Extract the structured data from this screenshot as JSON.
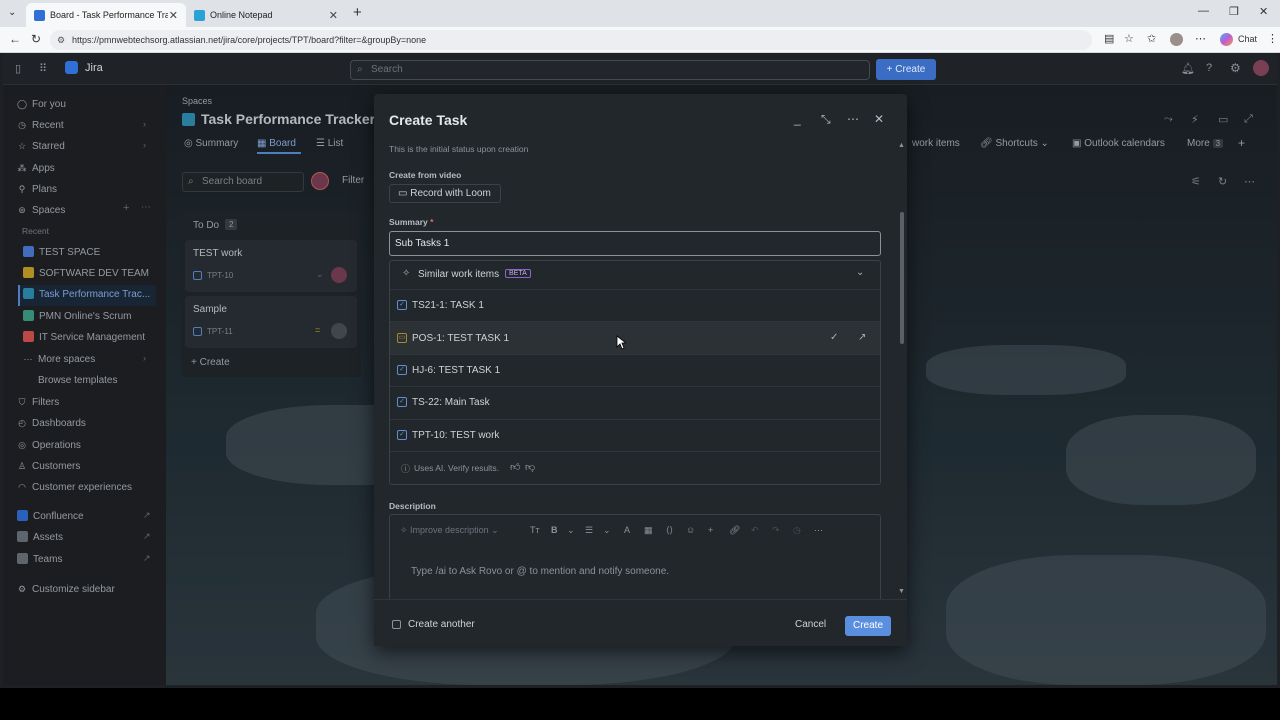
{
  "browser": {
    "tabs": [
      {
        "label": "Board - Task Performance Tracker",
        "active": true
      },
      {
        "label": "Online Notepad",
        "active": false
      }
    ],
    "url": "https://pmnwebtechsorg.atlassian.net/jira/core/projects/TPT/board?filter=&groupBy=none",
    "chat_label": "Chat"
  },
  "jira": {
    "app_name": "Jira",
    "search_placeholder": "Search",
    "create_label": "+ Create"
  },
  "sidebar": {
    "items": [
      {
        "label": "For you",
        "icon": "user-circle-icon"
      },
      {
        "label": "Recent",
        "icon": "clock-icon"
      },
      {
        "label": "Starred",
        "icon": "star-icon"
      },
      {
        "label": "Apps",
        "icon": "apps-icon"
      },
      {
        "label": "Plans",
        "icon": "plans-icon"
      },
      {
        "label": "Spaces",
        "icon": "spaces-icon"
      }
    ],
    "recent_heading": "Recent",
    "spaces": [
      {
        "label": "TEST SPACE",
        "color": "#4c7bd8"
      },
      {
        "label": "SOFTWARE DEV TEAM",
        "color": "#c9a227"
      },
      {
        "label": "Task Performance Trac...",
        "color": "#2f8fb3"
      },
      {
        "label": "PMN Online's Scrum",
        "color": "#3fa086"
      },
      {
        "label": "IT Service Management",
        "color": "#d9534f"
      }
    ],
    "more_spaces": "More spaces",
    "browse_templates": "Browse templates",
    "lower_items": [
      {
        "label": "Filters",
        "icon": "filter-icon"
      },
      {
        "label": "Dashboards",
        "icon": "dashboard-icon"
      },
      {
        "label": "Operations",
        "icon": "operations-icon"
      },
      {
        "label": "Customers",
        "icon": "customers-icon"
      },
      {
        "label": "Customer experiences",
        "icon": "experience-icon"
      }
    ],
    "apps": [
      {
        "label": "Confluence",
        "color": "#2f6fd6"
      },
      {
        "label": "Assets",
        "color": "#6b737d"
      },
      {
        "label": "Teams",
        "color": "#6b737d"
      }
    ],
    "customize": "Customize sidebar"
  },
  "project": {
    "breadcrumb": "Spaces",
    "title": "Task Performance Tracker",
    "tabs": [
      "Summary",
      "Board",
      "List"
    ],
    "right_tabs": [
      "work items",
      "Shortcuts",
      "Outlook calendars",
      "More"
    ],
    "more_count": "3",
    "search_board": "Search board",
    "filter": "Filter"
  },
  "board": {
    "column_title": "To Do",
    "column_count": "2",
    "cards": [
      {
        "title": "TEST work",
        "key": "TPT-10"
      },
      {
        "title": "Sample",
        "key": "TPT-11"
      }
    ],
    "create": "+ Create"
  },
  "modal": {
    "title": "Create Task",
    "status_hint": "This is the initial status upon creation",
    "create_from_video": "Create from video",
    "record_loom": "Record with Loom",
    "summary_label": "Summary",
    "summary_required": "*",
    "summary_value": "Sub Tasks 1",
    "similar_title": "Similar work items",
    "beta": "BETA",
    "similar_items": [
      {
        "text": "TS21-1: TASK 1",
        "type": "task"
      },
      {
        "text": "POS-1: TEST TASK 1",
        "type": "story"
      },
      {
        "text": "HJ-6: TEST TASK 1",
        "type": "task"
      },
      {
        "text": "TS-22: Main Task",
        "type": "task"
      },
      {
        "text": "TPT-10: TEST work",
        "type": "task"
      }
    ],
    "ai_note": "Uses AI. Verify results.",
    "description_label": "Description",
    "improve_description": "Improve description",
    "description_placeholder": "Type /ai to Ask Rovo or @ to mention and notify someone.",
    "create_another": "Create another",
    "cancel": "Cancel",
    "create": "Create"
  }
}
